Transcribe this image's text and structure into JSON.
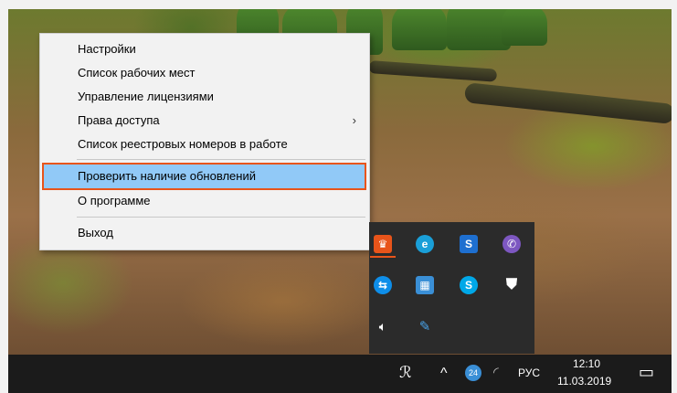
{
  "context_menu": {
    "items": [
      {
        "label": "Настройки"
      },
      {
        "label": "Список рабочих мест"
      },
      {
        "label": "Управление лицензиями"
      },
      {
        "label": "Права доступа",
        "submenu_glyph": "›"
      },
      {
        "label": "Список реестровых номеров в работе"
      },
      {
        "label": "Проверить наличие обновлений"
      },
      {
        "label": "О программе"
      },
      {
        "label": "Выход"
      }
    ]
  },
  "tray_flyout": {
    "icons": [
      {
        "name": "program-icon",
        "glyph": "♛",
        "color": "#e8541a"
      },
      {
        "name": "edge-icon",
        "glyph": "e",
        "color": "#1a9fd8"
      },
      {
        "name": "s-app-icon",
        "glyph": "S",
        "color": "#1e6fd0"
      },
      {
        "name": "viber-icon",
        "glyph": "✆",
        "color": "#7d57c1"
      },
      {
        "name": "teamviewer-icon",
        "glyph": "⇆",
        "color": "#0e8ee9"
      },
      {
        "name": "network-app-icon",
        "glyph": "▦",
        "color": "#3a8fd6"
      },
      {
        "name": "skype-icon",
        "glyph": "S",
        "color": "#00a8e8"
      },
      {
        "name": "defender-icon",
        "glyph": "⛊",
        "color": "#ffffff"
      },
      {
        "name": "volume-icon",
        "glyph": "🔈︎",
        "color": "#ffffff"
      },
      {
        "name": "tool-icon",
        "glyph": "✎",
        "color": "#4aa3e8"
      }
    ]
  },
  "taskbar": {
    "people_glyph": "ℛ",
    "chevron_glyph": "^",
    "badge": "24",
    "wifi_glyph": "◜",
    "language": "РУС",
    "time": "12:10",
    "date": "11.03.2019",
    "notification_glyph": "▭"
  },
  "colors": {
    "highlight": "#91c9f7",
    "highlight_border": "#e8541a",
    "taskbar": "#1b1b1b",
    "flyout": "#2b2b2b"
  }
}
